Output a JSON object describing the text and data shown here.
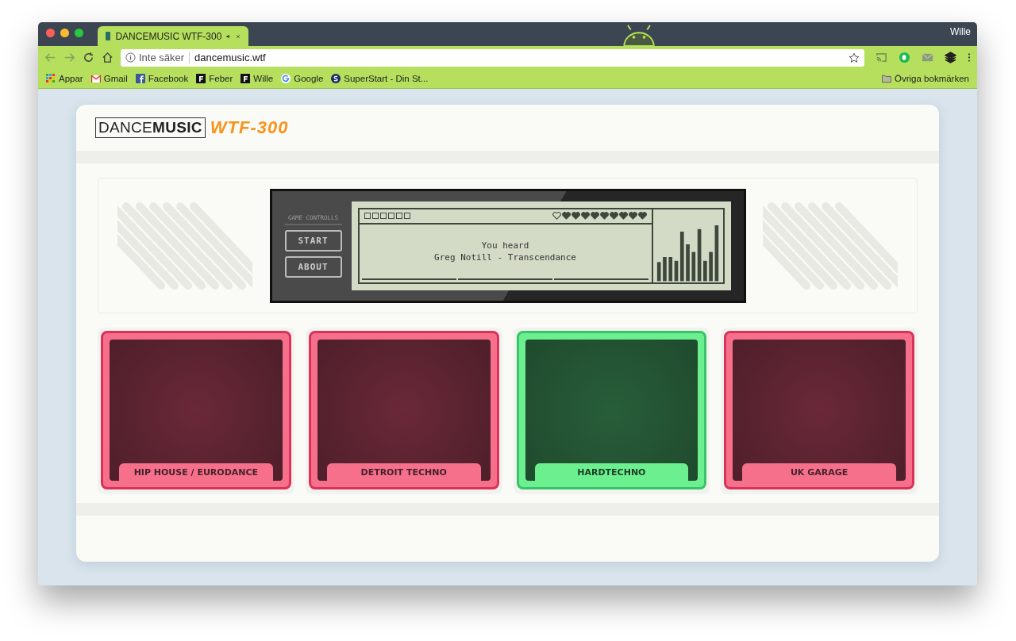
{
  "browser": {
    "tab": {
      "title": "DANCEMUSIC WTF-300",
      "selected": true
    },
    "profile": "Wille",
    "address": {
      "security": "Inte säker",
      "url": "dancemusic.wtf"
    },
    "bookmarks": [
      {
        "label": "Appar",
        "kind": "apps"
      },
      {
        "label": "Gmail",
        "kind": "gmail"
      },
      {
        "label": "Facebook",
        "kind": "facebook"
      },
      {
        "label": "Feber",
        "kind": "letter"
      },
      {
        "label": "Wille",
        "kind": "letter"
      },
      {
        "label": "Google",
        "kind": "google"
      },
      {
        "label": "SuperStart - Din St...",
        "kind": "s"
      }
    ],
    "other_bookmarks": "Övriga bokmärken"
  },
  "logo": {
    "brand": "DANCE**MUSIC**",
    "model": "WTF-300"
  },
  "game": {
    "controls_label": "GAME CONTROLLS",
    "buttons": [
      "START",
      "ABOUT"
    ],
    "squares": [
      {
        "filled": false
      },
      {
        "filled": false
      },
      {
        "filled": false
      },
      {
        "filled": false
      },
      {
        "filled": false
      },
      {
        "filled": false
      }
    ],
    "hearts": [
      {
        "filled": false
      },
      {
        "filled": true
      },
      {
        "filled": true
      },
      {
        "filled": true
      },
      {
        "filled": true
      },
      {
        "filled": true
      },
      {
        "filled": true
      },
      {
        "filled": true
      },
      {
        "filled": true
      },
      {
        "filled": true
      }
    ],
    "message": [
      "You heard",
      "Greg Notill - Transcendance"
    ]
  },
  "pads": [
    {
      "label": "HIP HOUSE / EURODANCE",
      "selected": false
    },
    {
      "label": "DETROIT TECHNO",
      "selected": false
    },
    {
      "label": "HARDTECHNO",
      "selected": true
    },
    {
      "label": "UK GARAGE",
      "selected": false
    }
  ]
}
